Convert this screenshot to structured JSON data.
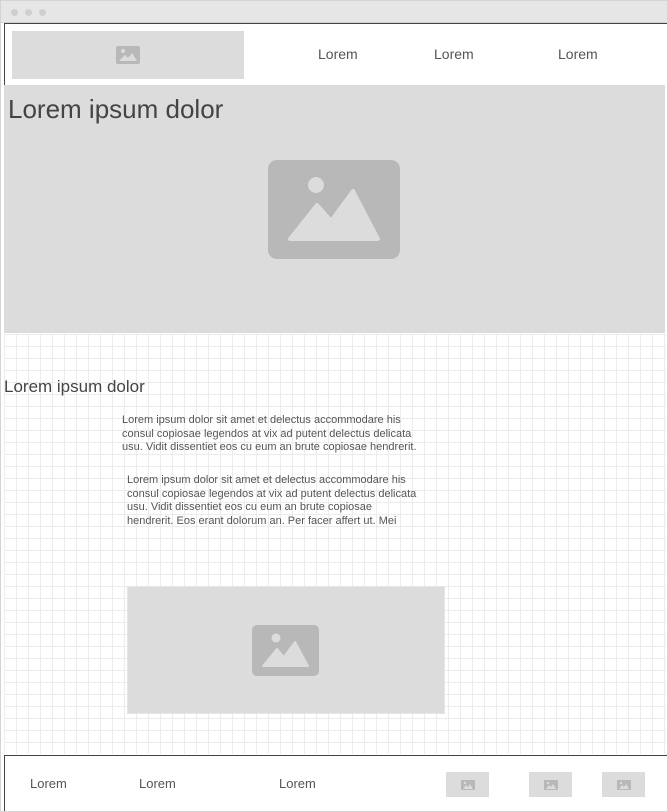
{
  "header": {
    "logo_icon": "image-placeholder-icon",
    "nav": [
      {
        "label": "Lorem"
      },
      {
        "label": "Lorem"
      },
      {
        "label": "Lorem"
      }
    ]
  },
  "hero": {
    "title": "Lorem ipsum dolor",
    "image_icon": "image-placeholder-icon"
  },
  "content": {
    "heading": "Lorem ipsum dolor",
    "paragraphs": [
      [
        "Lorem ipsum dolor sit amet et delectus accommodare his",
        "consul copiosae legendos at vix ad putent delectus delicata",
        "usu. Vidit dissentiet eos cu eum an brute copiosae hendrerit."
      ],
      [
        "Lorem ipsum dolor sit amet et delectus accommodare his",
        "consul copiosae legendos at vix ad putent delectus delicata",
        "usu. Vidit dissentiet eos cu eum an brute copiosae",
        "hendrerit. Eos erant dolorum an. Per facer affert ut. Mei"
      ]
    ],
    "image_icon": "image-placeholder-icon"
  },
  "footer": {
    "links": [
      {
        "label": "Lorem"
      },
      {
        "label": "Lorem"
      },
      {
        "label": "Lorem"
      }
    ],
    "images": [
      "image-placeholder-icon",
      "image-placeholder-icon",
      "image-placeholder-icon"
    ]
  },
  "colors": {
    "placeholder_bg": "#dcdcdc",
    "placeholder_icon": "#b8b8b8",
    "text": "#444444",
    "border": "#444444"
  }
}
